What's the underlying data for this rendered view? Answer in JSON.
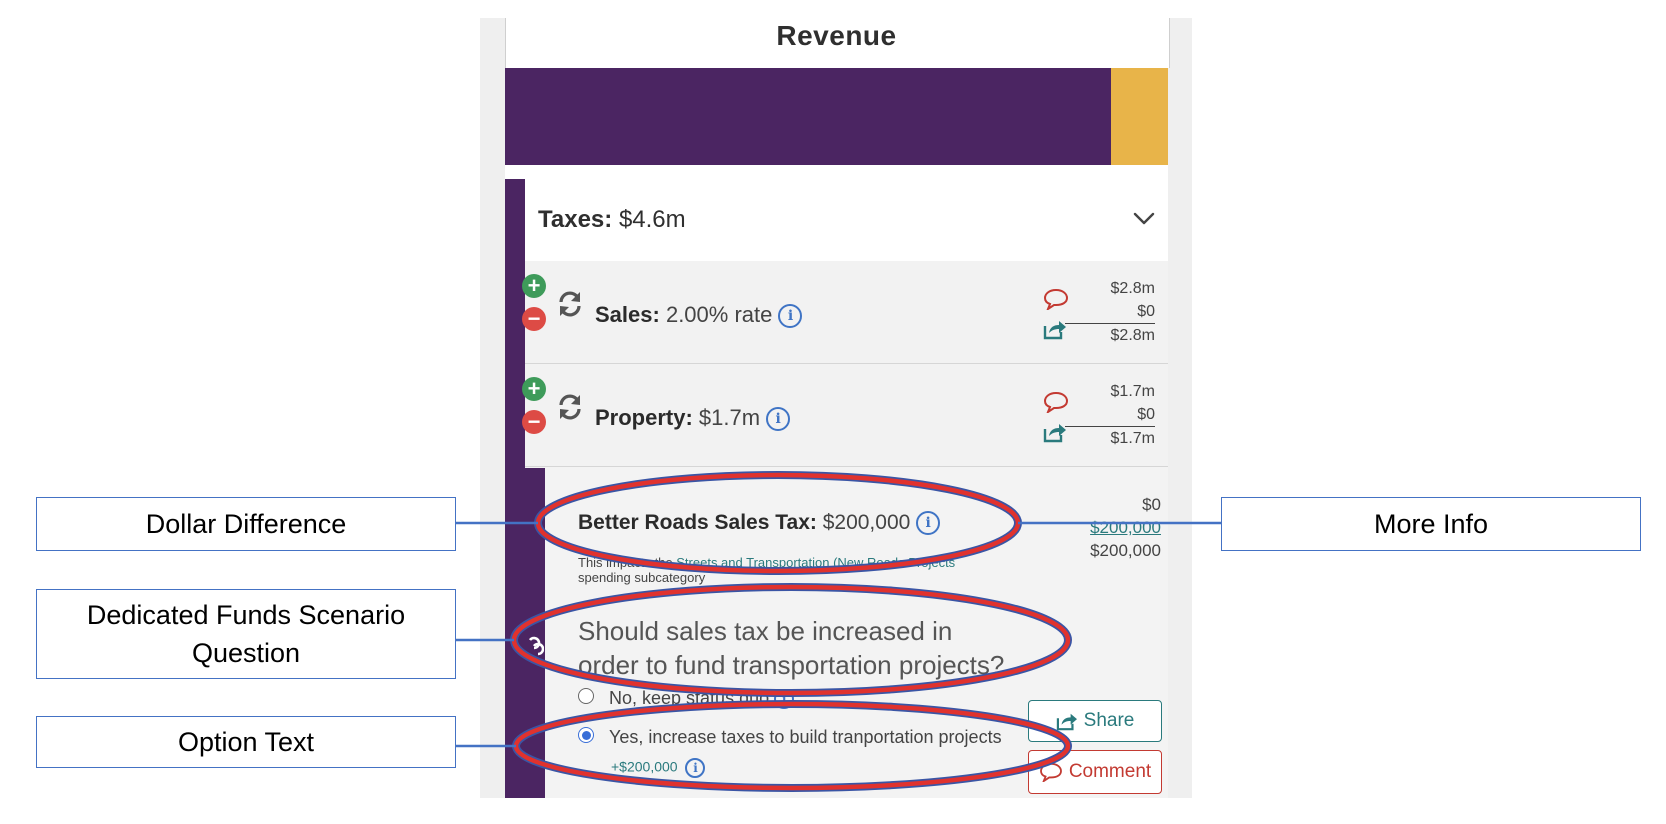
{
  "app": {
    "title": "Revenue",
    "budget_bar": {
      "purple_fraction": 0.914,
      "colors": {
        "primary": "#4b2562",
        "secondary": "#e8b449"
      }
    },
    "category": {
      "name": "Taxes:",
      "amount": "$4.6m",
      "chevron_icon": "chevron-down-icon"
    },
    "items": [
      {
        "name": "Sales:",
        "value": "2.00% rate",
        "amounts": [
          "$2.8m",
          "$0",
          "$2.8m"
        ]
      },
      {
        "name": "Property:",
        "value": "$1.7m",
        "amounts": [
          "$1.7m",
          "$0",
          "$1.7m"
        ]
      }
    ],
    "dedicated_fund": {
      "name": "Better Roads Sales Tax:",
      "value": "$200,000",
      "amounts": [
        "$0",
        "$200,000",
        "$200,000"
      ],
      "note_prefix": "This impacts the ",
      "note_link": "Streets and Transportation (New Roads Projects",
      "note_suffix": "spending subcategory",
      "question_line1": "Should sales tax be increased in",
      "question_line2": "order to fund transportation projects?",
      "options": [
        {
          "label": "No, keep status quo",
          "selected": false
        },
        {
          "label": "Yes, increase taxes to build tranportation projects",
          "selected": true,
          "delta": "+$200,000"
        }
      ],
      "share_label": "Share",
      "comment_label": "Comment"
    }
  },
  "annotations": {
    "dollar_difference": "Dollar Difference",
    "scenario_question_line1": "Dedicated Funds Scenario",
    "scenario_question_line2": "Question",
    "option_text": "Option Text",
    "more_info": "More Info"
  }
}
